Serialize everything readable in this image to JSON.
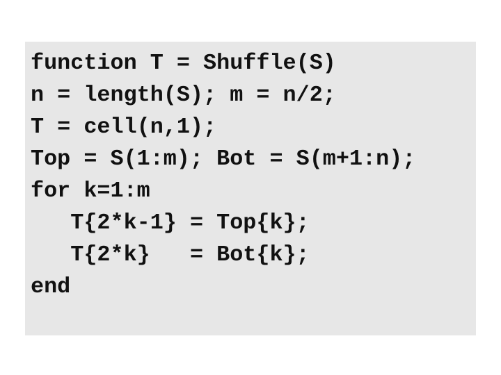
{
  "code": {
    "language": "MATLAB",
    "lines": [
      "function T = Shuffle(S)",
      "n = length(S); m = n/2;",
      "T = cell(n,1);",
      "Top = S(1:m); Bot = S(m+1:n);",
      "for k=1:m",
      "   T{2*k-1} = Top{k};",
      "   T{2*k}   = Bot{k};",
      "end"
    ]
  }
}
